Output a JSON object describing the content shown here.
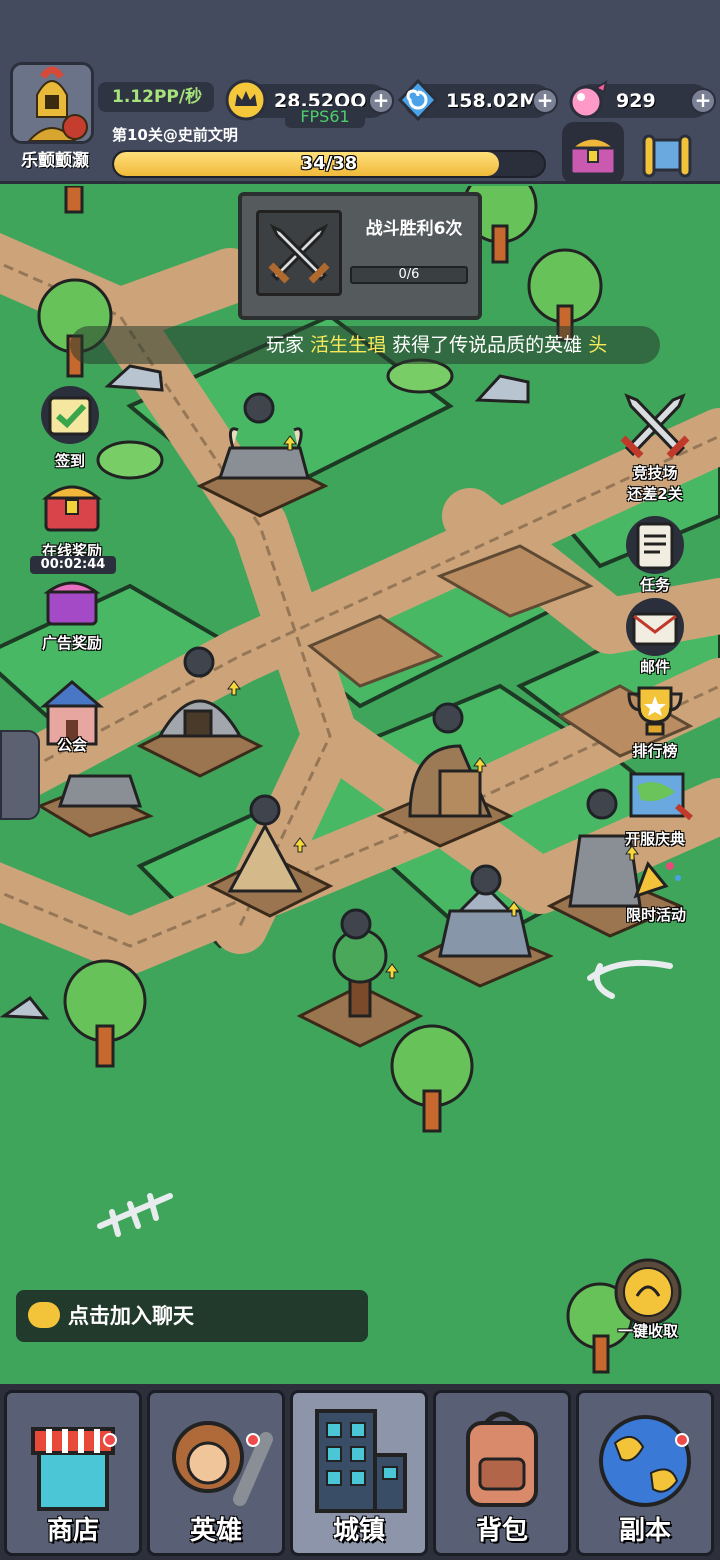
{
  "player": {
    "name": "乐颤颤灏",
    "rate": "1.12PP/秒",
    "level": "第10关@史前文明"
  },
  "progress": {
    "current": 34,
    "total": 38,
    "label": "34/38",
    "fraction": 0.895
  },
  "currencies": [
    {
      "icon": "crown-icon",
      "value": "28.52QQ"
    },
    {
      "icon": "swirl-gem-icon",
      "value": "158.02M"
    },
    {
      "icon": "candy-icon",
      "value": "929"
    }
  ],
  "fps": "FPS61",
  "quest": {
    "title": "战斗胜利6次",
    "progress": "0/6",
    "icon": "crossed-swords-icon"
  },
  "broadcast": {
    "prefix": "玩家",
    "player": "活生生琩",
    "text": "获得了传说品质的英雄",
    "tail": "头"
  },
  "left_buttons": {
    "signin": "签到",
    "online_reward": "在线奖励",
    "timer": "00:02:44",
    "ad_reward": "广告奖励",
    "guild": "公会"
  },
  "right_buttons": {
    "arena_title": "竞技场",
    "arena_sub": "还差2关",
    "tasks": "任务",
    "mail": "邮件",
    "ranking": "排行榜",
    "celebration": "开服庆典",
    "limited_event": "限时活动",
    "collect_all": "一键收取"
  },
  "chat": {
    "label": "点击加入聊天"
  },
  "nav": {
    "shop": "商店",
    "heroes": "英雄",
    "town": "城镇",
    "bag": "背包",
    "dungeon": "副本"
  },
  "colors": {
    "grass": "#3fa55a",
    "road": "#c9a27a",
    "topbar": "#454b5e",
    "progress": "#f0b93a"
  }
}
